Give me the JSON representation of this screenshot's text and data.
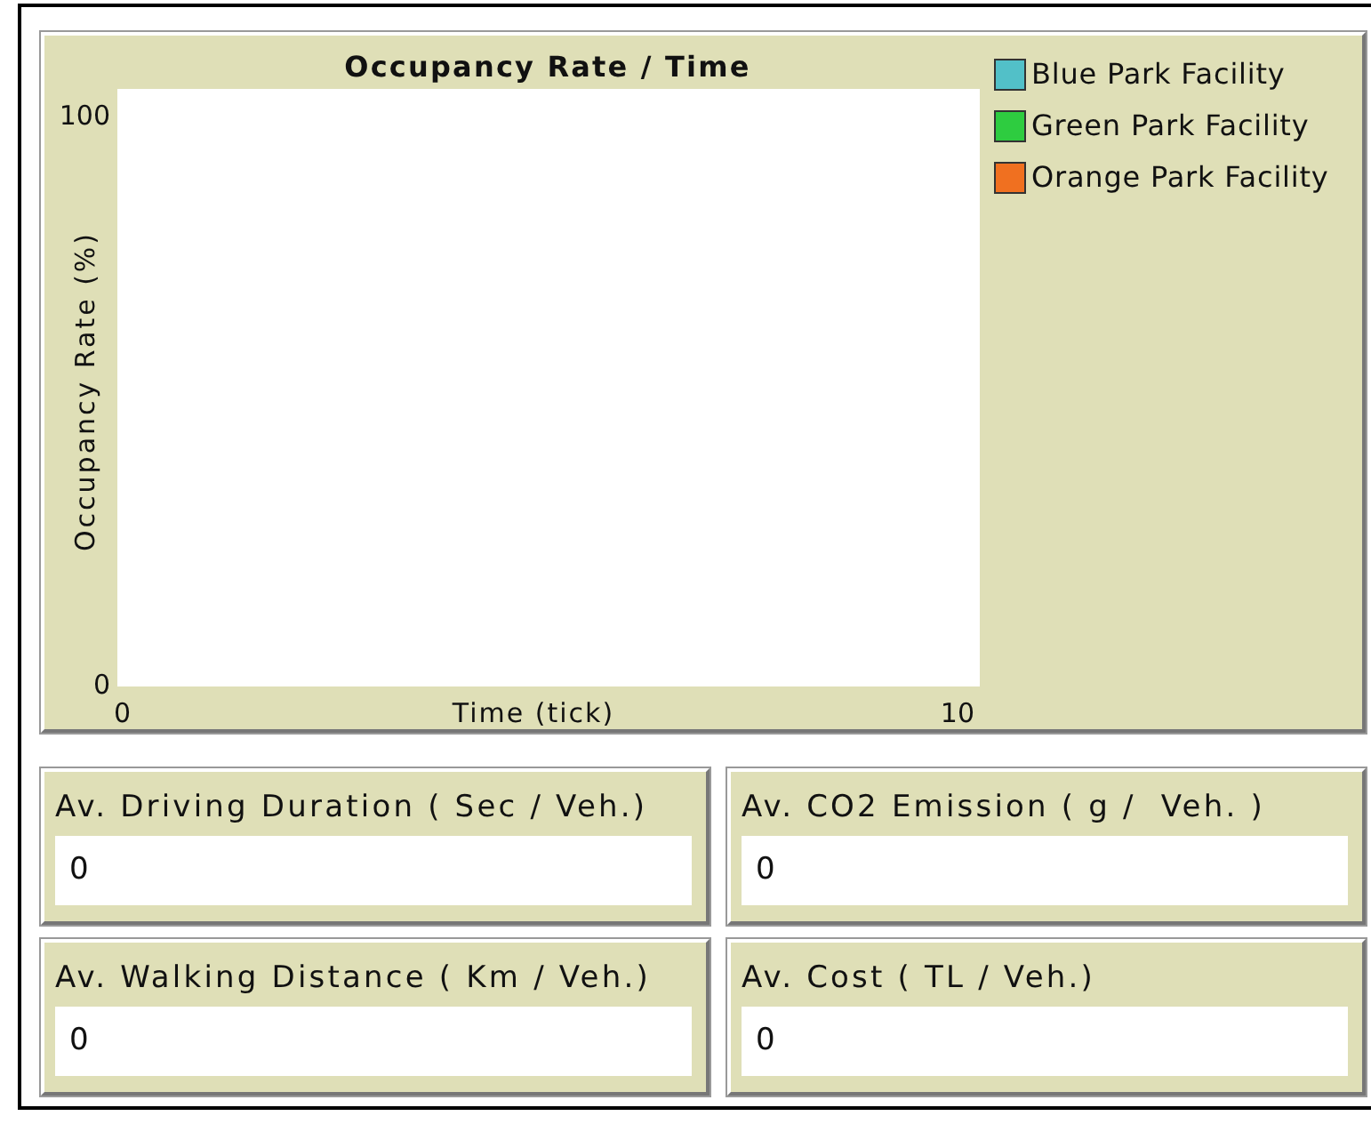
{
  "plot": {
    "title": "Occupancy Rate / Time",
    "x_label": "Time (tick)",
    "y_label": "Occupancy Rate (%)",
    "x_ticks": [
      "0",
      "10"
    ],
    "y_ticks": [
      "100",
      "0"
    ],
    "legend": [
      {
        "name": "Blue Park Facility",
        "color": "#52c0c8"
      },
      {
        "name": "Green Park Facility",
        "color": "#2ecc40"
      },
      {
        "name": "Orange Park Facility",
        "color": "#f07020"
      }
    ]
  },
  "monitors": [
    {
      "label": "Av. Driving Duration ( Sec / Veh.)",
      "value": "0"
    },
    {
      "label": "Av. CO2 Emission ( g /  Veh. )",
      "value": "0"
    },
    {
      "label": "Av. Walking Distance ( Km / Veh.)",
      "value": "0"
    },
    {
      "label": "Av. Cost ( TL / Veh.)",
      "value": "0"
    }
  ]
}
